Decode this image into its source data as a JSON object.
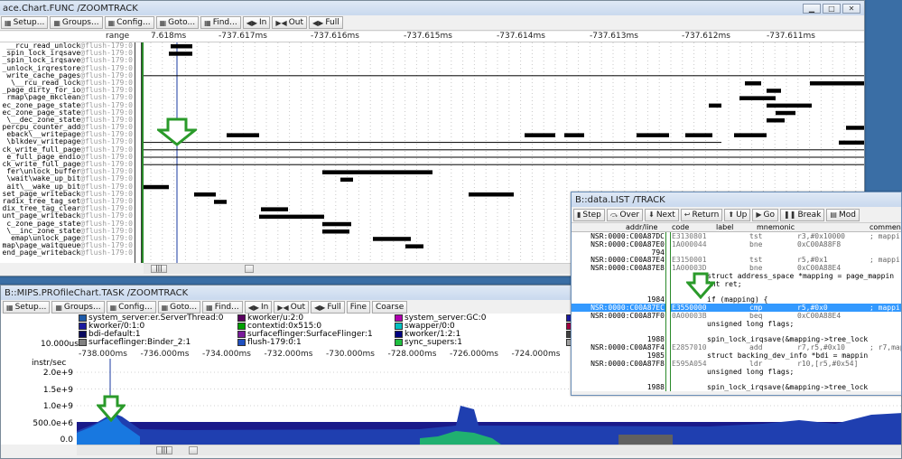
{
  "chart_window": {
    "title": "ace.Chart.FUNC /ZOOMTRACK",
    "toolbar": [
      {
        "label": "Setup...",
        "icon": "setup-icon"
      },
      {
        "label": "Groups...",
        "icon": "groups-icon"
      },
      {
        "label": "Config...",
        "icon": "config-icon"
      },
      {
        "label": "Goto...",
        "icon": "goto-icon"
      },
      {
        "label": "Find...",
        "icon": "find-icon"
      },
      {
        "label": "In",
        "icon": "zoom-in-icon"
      },
      {
        "label": "Out",
        "icon": "zoom-out-icon"
      },
      {
        "label": "Full",
        "icon": "full-icon"
      }
    ],
    "range_label": "range",
    "time_ticks": [
      "7.618ms",
      "-737.617ms",
      "-737.616ms",
      "-737.615ms",
      "-737.614ms",
      "-737.613ms",
      "-737.612ms",
      "-737.611ms"
    ],
    "functions": [
      {
        "name": "__rcu_read_unlock",
        "suffix": "@flush-179:0"
      },
      {
        "name": "_spin_lock_irqsave",
        "suffix": "@flush-179:0"
      },
      {
        "name": "_spin_lock_irqsave",
        "suffix": "@flush-179:0"
      },
      {
        "name": "_unlock_irqrestore",
        "suffix": "@flush-179:0"
      },
      {
        "name": "write_cache_pages",
        "suffix": "@flush-179:0"
      },
      {
        "name": "\\__rcu_read_lock",
        "suffix": "@flush-179:0"
      },
      {
        "name": "_page_dirty_for_io",
        "suffix": "@flush-179:0"
      },
      {
        "name": "rmap\\page_mkclean",
        "suffix": "@flush-179:0"
      },
      {
        "name": "ec_zone_page_state",
        "suffix": "@flush-179:0"
      },
      {
        "name": "ec_zone_page_state",
        "suffix": "@flush-179:0"
      },
      {
        "name": "\\__dec_zone_state",
        "suffix": "@flush-179:0"
      },
      {
        "name": "percpu_counter_add",
        "suffix": "@flush-179:0"
      },
      {
        "name": "eback\\__writepage",
        "suffix": "@flush-179:0"
      },
      {
        "name": "\\blkdev_writepage",
        "suffix": "@flush-179:0"
      },
      {
        "name": "ck_write_full_page",
        "suffix": "@flush-179:0"
      },
      {
        "name": "e_full_page_endio",
        "suffix": "@flush-179:0"
      },
      {
        "name": "ck_write_full_page",
        "suffix": "@flush-179:0"
      },
      {
        "name": "fer\\unlock_buffer",
        "suffix": "@flush-179:0"
      },
      {
        "name": "\\wait\\wake_up_bit",
        "suffix": "@flush-179:0"
      },
      {
        "name": "ait\\__wake_up_bit",
        "suffix": "@flush-179:0"
      },
      {
        "name": "set_page_writeback",
        "suffix": "@flush-179:0"
      },
      {
        "name": "radix_tree_tag_set",
        "suffix": "@flush-179:0"
      },
      {
        "name": "dix_tree_tag_clear",
        "suffix": "@flush-179:0"
      },
      {
        "name": "unt_page_writeback",
        "suffix": "@flush-179:0"
      },
      {
        "name": "c_zone_page_state",
        "suffix": "@flush-179:0"
      },
      {
        "name": "\\__inc_zone_state",
        "suffix": "@flush-179:0"
      },
      {
        "name": "emap\\unlock_page",
        "suffix": "@flush-179:0"
      },
      {
        "name": "map\\page_waitqueue",
        "suffix": "@flush-179:0"
      },
      {
        "name": "end_page_writeback",
        "suffix": "@flush-179:0"
      }
    ]
  },
  "profile_window": {
    "title": "B::MIPS.PROfileChart.TASK /ZOOMTRACK",
    "toolbar": [
      {
        "label": "Setup...",
        "icon": "setup-icon"
      },
      {
        "label": "Groups...",
        "icon": "groups-icon"
      },
      {
        "label": "Config...",
        "icon": "config-icon"
      },
      {
        "label": "Goto...",
        "icon": "goto-icon"
      },
      {
        "label": "Find...",
        "icon": "find-icon"
      },
      {
        "label": "In",
        "icon": "zoom-in-icon"
      },
      {
        "label": "Out",
        "icon": "zoom-out-icon"
      },
      {
        "label": "Full",
        "icon": "full-icon"
      },
      {
        "label": "Fine",
        "icon": ""
      },
      {
        "label": "Coarse",
        "icon": ""
      }
    ],
    "legend": [
      {
        "name": "system_server:er.ServerThread:0",
        "color": "#1e5aa8"
      },
      {
        "name": "kworker/0:1:0",
        "color": "#1a1aa0"
      },
      {
        "name": "bdi-default:1",
        "color": "#0a0a60"
      },
      {
        "name": "surfaceflinger:Binder_2:1",
        "color": "#808080"
      },
      {
        "name": "kworker/u:2:0",
        "color": "#5a0060"
      },
      {
        "name": "contextid:0x515:0",
        "color": "#00a000"
      },
      {
        "name": "surfaceflinger:SurfaceFlinger:1",
        "color": "#7a1a9a"
      },
      {
        "name": "flush-179:0:1",
        "color": "#2050c0"
      },
      {
        "name": "system_server:GC:0",
        "color": "#b000b0"
      },
      {
        "name": "swapper/0:0",
        "color": "#00c0c0"
      },
      {
        "name": "kworker/1:2:1",
        "color": "#000080"
      },
      {
        "name": "sync_supers:1",
        "color": "#20c040"
      },
      {
        "name": "k",
        "color": "#1a1aa0"
      },
      {
        "name": "k",
        "color": "#a00040"
      },
      {
        "name": "k",
        "color": "#404040"
      },
      {
        "name": "m",
        "color": "#a0a0a0"
      }
    ],
    "scale_label": "10.000us",
    "x_ticks": [
      "-738.000ms",
      "-736.000ms",
      "-734.000ms",
      "-732.000ms",
      "-730.000ms",
      "-728.000ms",
      "-726.000ms",
      "-724.000ms"
    ],
    "y_unit": "instr/sec",
    "y_ticks": [
      "2.0e+9",
      "1.5e+9",
      "1.0e+9",
      "500.0e+6",
      "0.0"
    ]
  },
  "list_window": {
    "title": "B::data.LIST /TRACK",
    "toolbar": [
      {
        "label": "Step",
        "icon": "step-icon"
      },
      {
        "label": "Over",
        "icon": "over-icon"
      },
      {
        "label": "Next",
        "icon": "next-icon"
      },
      {
        "label": "Return",
        "icon": "return-icon"
      },
      {
        "label": "Up",
        "icon": "up-icon"
      },
      {
        "label": "Go",
        "icon": "go-icon"
      },
      {
        "label": "Break",
        "icon": "break-icon"
      },
      {
        "label": "Mod",
        "icon": "mode-icon"
      }
    ],
    "columns": [
      "addr/line",
      "code",
      "label",
      "mnemonic",
      "comment"
    ],
    "rows": [
      {
        "type": "asm",
        "addr": "NSR:0000:C00A87DC",
        "code": "E3130801",
        "mn": "tst",
        "op": "r3,#0x10000",
        "cm": "; mappi"
      },
      {
        "type": "asm",
        "addr": "NSR:0000:C00A87E0",
        "code": "1A000044",
        "mn": "bne",
        "op": "0xC00A88F8",
        "cm": ""
      },
      {
        "type": "line",
        "line": "794",
        "text": ""
      },
      {
        "type": "asm",
        "addr": "NSR:0000:C00A87E4",
        "code": "E3150001",
        "mn": "tst",
        "op": "r5,#0x1",
        "cm": "; mappi"
      },
      {
        "type": "asm",
        "addr": "NSR:0000:C00A87E8",
        "code": "1A00003D",
        "mn": "bne",
        "op": "0xC00A88E4",
        "cm": ""
      },
      {
        "type": "src",
        "line": "",
        "text": "struct address_space *mapping = page_mappin"
      },
      {
        "type": "src",
        "line": "",
        "text": "int ret;"
      },
      {
        "type": "blank"
      },
      {
        "type": "src",
        "line": "1984",
        "text": "if (mapping) {"
      },
      {
        "type": "sel",
        "addr": "NSR:0000:C00A87EC",
        "code": "E3550000",
        "mn": "cmp",
        "op": "r5,#0x0",
        "cm": "; mappi"
      },
      {
        "type": "asm",
        "addr": "NSR:0000:C00A87F0",
        "code": "0A00003B",
        "mn": "beq",
        "op": "0xC00A88E4",
        "cm": ""
      },
      {
        "type": "src",
        "line": "",
        "text": "unsigned long flags;"
      },
      {
        "type": "blank"
      },
      {
        "type": "src",
        "line": "1988",
        "text": "spin_lock_irqsave(&mapping->tree_lock"
      },
      {
        "type": "asm",
        "addr": "NSR:0000:C00A87F4",
        "code": "E2857010",
        "mn": "add",
        "op": "r7,r5,#0x10",
        "cm": "; r7,map"
      },
      {
        "type": "src",
        "line": "1985",
        "text": "struct backing_dev_info *bdi = mappin"
      },
      {
        "type": "asm",
        "addr": "NSR:0000:C00A87F8",
        "code": "E595A054",
        "mn": "ldr",
        "op": "r10,[r5,#0x54]",
        "cm": ""
      },
      {
        "type": "src",
        "line": "",
        "text": "unsigned long flags;"
      },
      {
        "type": "blank"
      },
      {
        "type": "src",
        "line": "1988",
        "text": "spin_lock_irqsave(&mapping->tree_lock"
      }
    ]
  }
}
